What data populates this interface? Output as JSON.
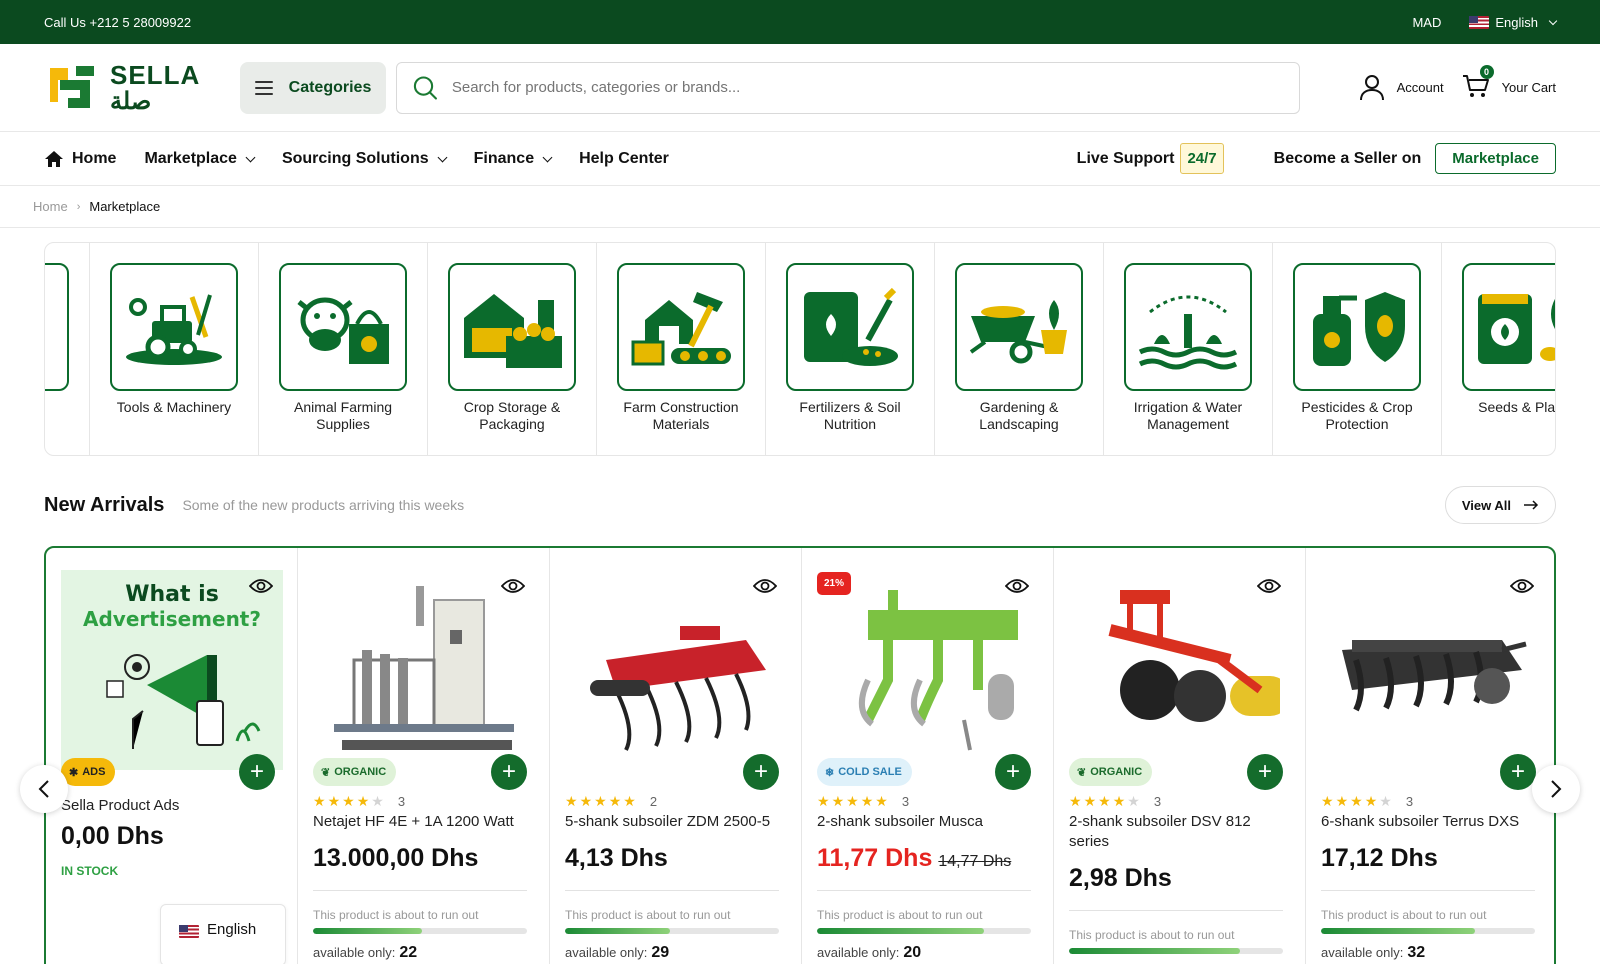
{
  "topbar": {
    "phone": "Call Us +212 5 28009922",
    "currency": "MAD",
    "language": "English"
  },
  "header": {
    "logo_en": "SELLA",
    "logo_ar": "صلة",
    "categories_label": "Categories",
    "search_placeholder": "Search for products, categories or brands...",
    "account_label": "Account",
    "cart_label": "Your Cart",
    "cart_count": "0"
  },
  "nav": {
    "home": "Home",
    "marketplace": "Marketplace",
    "sourcing": "Sourcing Solutions",
    "finance": "Finance",
    "help": "Help Center",
    "live_support": "Live Support",
    "support_badge": "24/7",
    "become_seller": "Become a Seller on",
    "seller_button": "Marketplace"
  },
  "breadcrumb": {
    "home": "Home",
    "current": "Marketplace"
  },
  "categories": [
    {
      "label": "Tools & Machinery",
      "icon": "tractor-tools-icon"
    },
    {
      "label": "Animal Farming Supplies",
      "icon": "cow-feed-icon"
    },
    {
      "label": "Crop Storage & Packaging",
      "icon": "barn-crate-icon"
    },
    {
      "label": "Farm Construction Materials",
      "icon": "barn-hammer-icon"
    },
    {
      "label": "Fertilizers & Soil Nutrition",
      "icon": "fertilizer-bag-icon"
    },
    {
      "label": "Gardening & Landscaping",
      "icon": "wheelbarrow-icon"
    },
    {
      "label": "Irrigation & Water Management",
      "icon": "sprinkler-icon"
    },
    {
      "label": "Pesticides & Crop Protection",
      "icon": "spray-shield-icon"
    },
    {
      "label": "Seeds & Plants",
      "icon": "seed-bag-icon"
    }
  ],
  "new_arrivals": {
    "title": "New Arrivals",
    "subtitle": "Some of the new products arriving this weeks",
    "view_all": "View All",
    "runout_text": "This product is about to run out",
    "available_label": "available only:",
    "products": [
      {
        "name": "Sella Product Ads",
        "price": "0,00 Dhs",
        "tag": "ADS",
        "stock": "IN STOCK",
        "ad_title_1": "What is",
        "ad_title_2": "Advertisement?"
      },
      {
        "name": "Netajet HF 4E + 1A 1200 Watt",
        "price": "13.000,00 Dhs",
        "tag": "ORGANIC",
        "rating": 4,
        "reviews": "3",
        "available": "22",
        "stock_level": 0.51
      },
      {
        "name": "5-shank subsoiler ZDM 2500-5",
        "price": "4,13 Dhs",
        "rating": 4.5,
        "reviews": "2",
        "available": "29",
        "stock_level": 0.49
      },
      {
        "name": "2-shank subsoiler Musca",
        "price": "11,77 Dhs",
        "old_price": "14,77 Dhs",
        "discount": "21%",
        "tag": "COLD SALE",
        "rating": 4.5,
        "reviews": "3",
        "available": "20",
        "stock_level": 0.78
      },
      {
        "name": "2-shank subsoiler DSV 812 series",
        "price": "2,98 Dhs",
        "tag": "ORGANIC",
        "rating": 3.5,
        "reviews": "3",
        "stock_level": 0.8
      },
      {
        "name": "6-shank subsoiler Terrus DXS",
        "price": "17,12 Dhs",
        "rating": 4,
        "reviews": "3",
        "available": "32",
        "stock_level": 0.72
      }
    ]
  },
  "language_popup": "English",
  "colors": {
    "brand_dark": "#0b4a1f",
    "brand_green": "#146c2c",
    "accent_yellow": "#f5b90a",
    "sale_red": "#e52420"
  }
}
